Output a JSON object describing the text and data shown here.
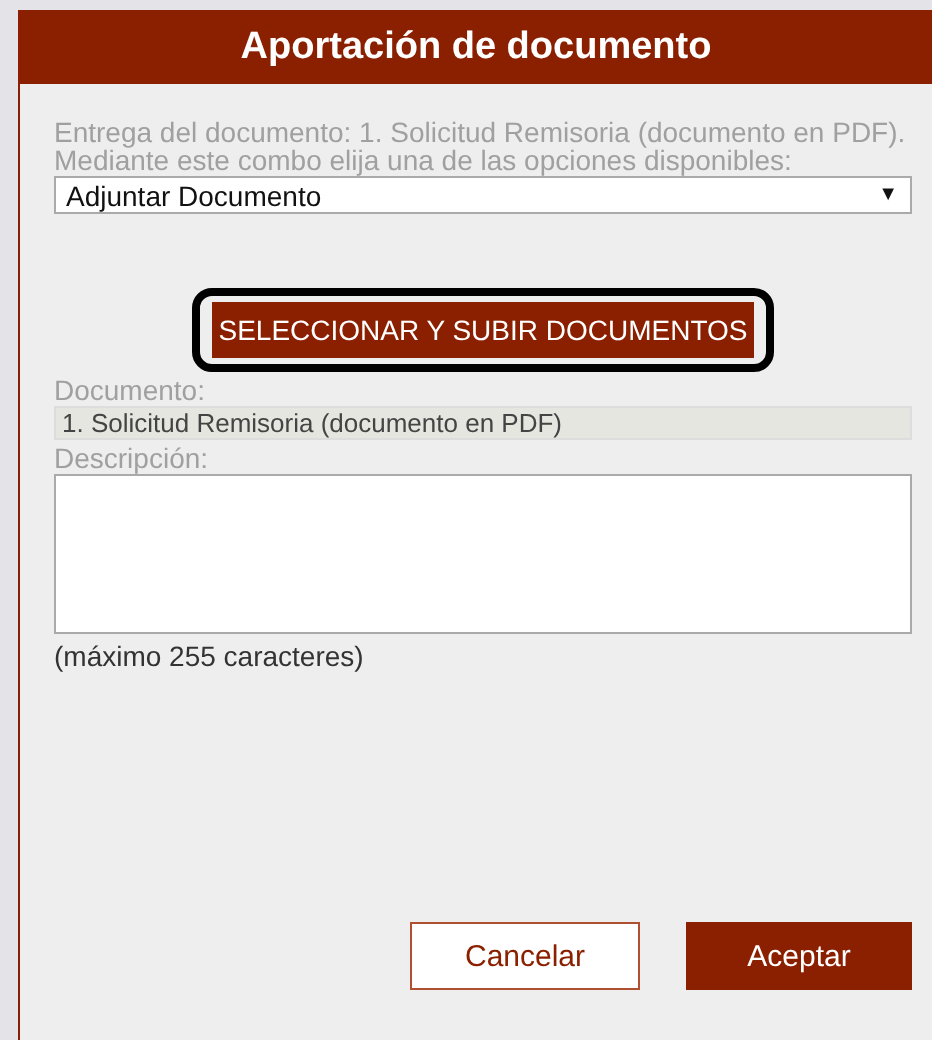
{
  "dialog": {
    "title": "Aportación de documento"
  },
  "intro": "Entrega del documento: 1. Solicitud Remisoria (documento en PDF). Mediante este combo elija una de las opciones disponibles:",
  "combo": {
    "value": "Adjuntar Documento",
    "arrow": "▼"
  },
  "upload_button": {
    "label": "SELECCIONAR Y SUBIR DOCUMENTOS",
    "highlighted": true
  },
  "document": {
    "label": "Documento:",
    "value": "1. Solicitud Remisoria (documento en PDF)"
  },
  "description": {
    "label": "Descripción:",
    "note": "(máximo 255 caracteres)"
  },
  "buttons": [
    {
      "label": "Cancelar",
      "kind": "secondary"
    },
    {
      "label": "Aceptar",
      "kind": "primary"
    }
  ]
}
